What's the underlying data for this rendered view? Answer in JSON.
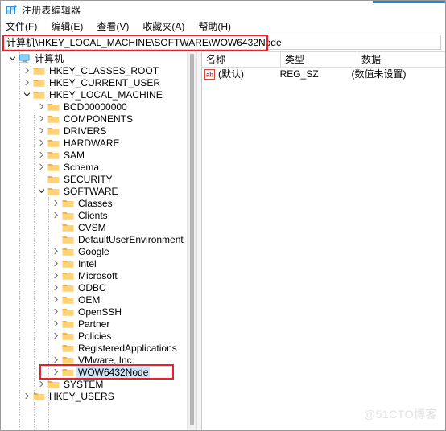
{
  "window": {
    "title": "注册表编辑器",
    "icon": "registry-editor-icon",
    "accent_color": "#1e8bd6"
  },
  "menu": {
    "items": [
      {
        "label": "文件(F)",
        "name": "file"
      },
      {
        "label": "编辑(E)",
        "name": "edit"
      },
      {
        "label": "查看(V)",
        "name": "view"
      },
      {
        "label": "收藏夹(A)",
        "name": "favorites"
      },
      {
        "label": "帮助(H)",
        "name": "help"
      }
    ]
  },
  "address_bar": {
    "value": "计算机\\HKEY_LOCAL_MACHINE\\SOFTWARE\\WOW6432Node",
    "placeholder": "计算机\\",
    "annotated": true,
    "annotation_color": "#e8222a"
  },
  "tree": {
    "selected_key": "WOW6432Node",
    "annotation_color": "#e8222a",
    "nodes": [
      {
        "label": "计算机",
        "depth": 0,
        "state": "expanded",
        "icon": "computer-icon",
        "selected": false
      },
      {
        "label": "HKEY_CLASSES_ROOT",
        "depth": 1,
        "state": "collapsed",
        "icon": "folder-icon",
        "selected": false
      },
      {
        "label": "HKEY_CURRENT_USER",
        "depth": 1,
        "state": "collapsed",
        "icon": "folder-icon",
        "selected": false
      },
      {
        "label": "HKEY_LOCAL_MACHINE",
        "depth": 1,
        "state": "expanded",
        "icon": "folder-icon",
        "selected": false
      },
      {
        "label": "BCD00000000",
        "depth": 2,
        "state": "collapsed",
        "icon": "folder-icon",
        "selected": false
      },
      {
        "label": "COMPONENTS",
        "depth": 2,
        "state": "collapsed",
        "icon": "folder-icon",
        "selected": false
      },
      {
        "label": "DRIVERS",
        "depth": 2,
        "state": "collapsed",
        "icon": "folder-icon",
        "selected": false
      },
      {
        "label": "HARDWARE",
        "depth": 2,
        "state": "collapsed",
        "icon": "folder-icon",
        "selected": false
      },
      {
        "label": "SAM",
        "depth": 2,
        "state": "collapsed",
        "icon": "folder-icon",
        "selected": false
      },
      {
        "label": "Schema",
        "depth": 2,
        "state": "collapsed",
        "icon": "folder-icon",
        "selected": false
      },
      {
        "label": "SECURITY",
        "depth": 2,
        "state": "leaf",
        "icon": "folder-icon",
        "selected": false
      },
      {
        "label": "SOFTWARE",
        "depth": 2,
        "state": "expanded",
        "icon": "folder-icon",
        "selected": false
      },
      {
        "label": "Classes",
        "depth": 3,
        "state": "collapsed",
        "icon": "folder-icon",
        "selected": false
      },
      {
        "label": "Clients",
        "depth": 3,
        "state": "collapsed",
        "icon": "folder-icon",
        "selected": false
      },
      {
        "label": "CVSM",
        "depth": 3,
        "state": "leaf",
        "icon": "folder-icon",
        "selected": false
      },
      {
        "label": "DefaultUserEnvironment",
        "depth": 3,
        "state": "leaf",
        "icon": "folder-icon",
        "selected": false
      },
      {
        "label": "Google",
        "depth": 3,
        "state": "collapsed",
        "icon": "folder-icon",
        "selected": false
      },
      {
        "label": "Intel",
        "depth": 3,
        "state": "collapsed",
        "icon": "folder-icon",
        "selected": false
      },
      {
        "label": "Microsoft",
        "depth": 3,
        "state": "collapsed",
        "icon": "folder-icon",
        "selected": false
      },
      {
        "label": "ODBC",
        "depth": 3,
        "state": "collapsed",
        "icon": "folder-icon",
        "selected": false
      },
      {
        "label": "OEM",
        "depth": 3,
        "state": "collapsed",
        "icon": "folder-icon",
        "selected": false
      },
      {
        "label": "OpenSSH",
        "depth": 3,
        "state": "collapsed",
        "icon": "folder-icon",
        "selected": false
      },
      {
        "label": "Partner",
        "depth": 3,
        "state": "collapsed",
        "icon": "folder-icon",
        "selected": false
      },
      {
        "label": "Policies",
        "depth": 3,
        "state": "collapsed",
        "icon": "folder-icon",
        "selected": false
      },
      {
        "label": "RegisteredApplications",
        "depth": 3,
        "state": "leaf",
        "icon": "folder-icon",
        "selected": false
      },
      {
        "label": "VMware, Inc.",
        "depth": 3,
        "state": "collapsed",
        "icon": "folder-icon",
        "selected": false
      },
      {
        "label": "WOW6432Node",
        "depth": 3,
        "state": "collapsed",
        "icon": "folder-icon",
        "selected": true
      },
      {
        "label": "SYSTEM",
        "depth": 2,
        "state": "collapsed",
        "icon": "folder-icon",
        "selected": false
      },
      {
        "label": "HKEY_USERS",
        "depth": 1,
        "state": "collapsed",
        "icon": "folder-icon",
        "selected": false
      }
    ]
  },
  "value_list": {
    "columns": [
      {
        "label": "名称",
        "name": "name"
      },
      {
        "label": "类型",
        "name": "type"
      },
      {
        "label": "数据",
        "name": "data"
      }
    ],
    "rows": [
      {
        "name": "(默认)",
        "type": "REG_SZ",
        "data": "(数值未设置)",
        "icon": "string-value-icon"
      }
    ]
  },
  "watermark": {
    "text": "@51CTO博客"
  }
}
